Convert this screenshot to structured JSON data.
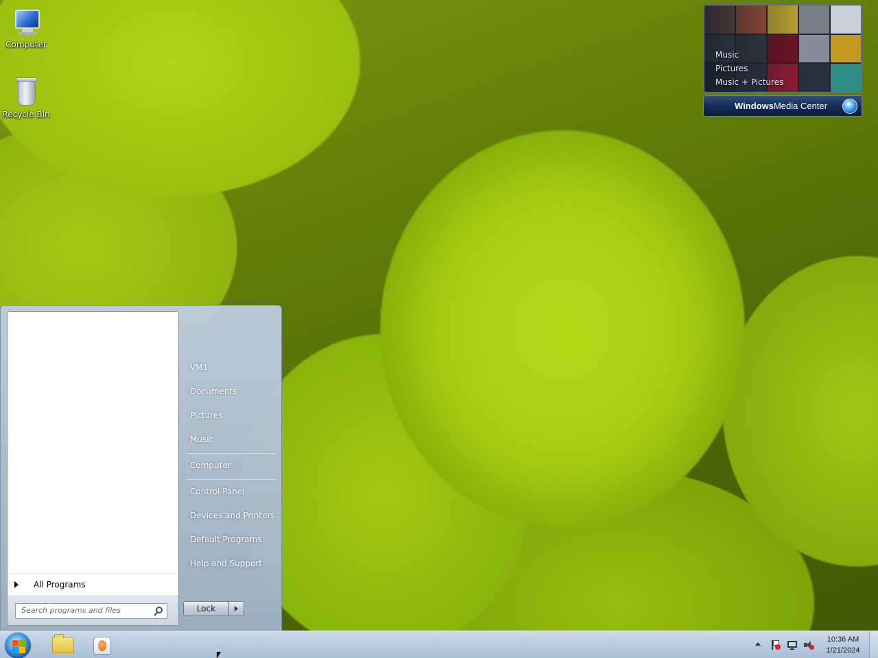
{
  "desktop": {
    "icons": [
      {
        "label": "Computer"
      },
      {
        "label": "Recycle Bin"
      }
    ]
  },
  "media_center_gadget": {
    "list": [
      "Music",
      "Pictures",
      "Music + Pictures"
    ],
    "bar_bold": "Windows",
    "bar_text": " Media Center"
  },
  "start_menu": {
    "right_items": [
      "VM1",
      "Documents",
      "Pictures",
      "Music",
      "Computer",
      "Control Panel",
      "Devices and Printers",
      "Default Programs",
      "Help and Support"
    ],
    "all_programs": "All Programs",
    "search_placeholder": "Search programs and files",
    "lock_label": "Lock"
  },
  "taskbar": {
    "clock_time": "10:36 AM",
    "clock_date": "1/21/2024"
  },
  "colors": {
    "start_menu_bg": "#b0c0d4",
    "taskbar_bg": "#b8cbe0",
    "wallpaper_green": "#a5cc12"
  }
}
